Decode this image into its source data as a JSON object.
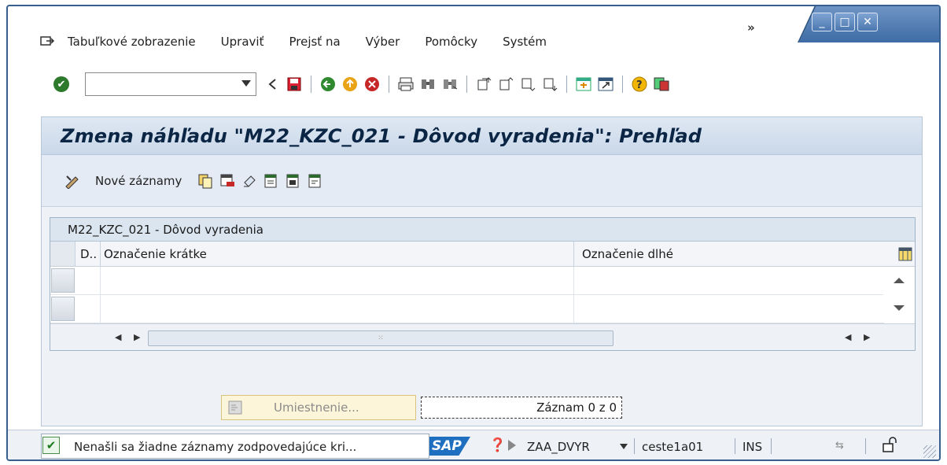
{
  "window": {
    "overflow_label": "»",
    "minimize_label": "_",
    "maximize_label": "□",
    "close_label": "✕"
  },
  "menubar": {
    "items": [
      {
        "label": "Tabuľkové zobrazenie"
      },
      {
        "label": "Upraviť"
      },
      {
        "label": "Prejsť na"
      },
      {
        "label": "Výber"
      },
      {
        "label": "Pomôcky"
      },
      {
        "label": "Systém"
      }
    ]
  },
  "toolbar": {
    "command_field_value": "",
    "icons": [
      "enter-icon",
      "back-icon",
      "save-icon",
      "green-back-icon",
      "exit-icon",
      "cancel-icon",
      "print-icon",
      "find-icon",
      "find-next-icon",
      "first-page-icon",
      "prev-page-icon",
      "next-page-icon",
      "last-page-icon",
      "create-session-icon",
      "shortcut-icon",
      "help-icon",
      "customize-icon"
    ]
  },
  "screen": {
    "title": "Zmena náhľadu \"M22_KZC_021  - Dôvod vyradenia\": Prehľad"
  },
  "app_toolbar": {
    "new_entries_label": "Nové záznamy"
  },
  "table": {
    "caption": "M22_KZC_021  - Dôvod vyradenia",
    "columns": {
      "d": "D..",
      "short": "Označenie krátke",
      "long": "Označenie dlhé"
    },
    "rows": [
      {
        "d": "",
        "short": "",
        "long": ""
      },
      {
        "d": "",
        "short": "",
        "long": ""
      }
    ]
  },
  "buttons": {
    "position_label": "Umiestnenie..."
  },
  "record_counter": "Záznam 0 z 0",
  "statusbar": {
    "message": "Nenašli sa žiadne záznamy zodpovedajúce kri...",
    "logo": "SAP",
    "system": "ZAA_DVYR",
    "host": "ceste1a01",
    "mode": "INS"
  }
}
